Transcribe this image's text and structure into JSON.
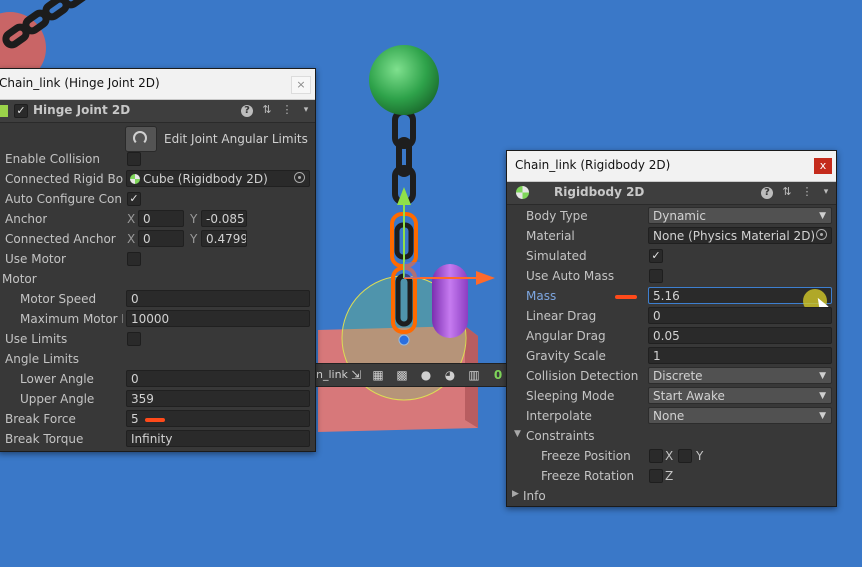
{
  "hinge_window": {
    "title": "Chain_link (Hinge Joint 2D)",
    "close": "×",
    "component": "Hinge Joint 2D",
    "enabled_check": "✓",
    "help": "?",
    "settings": "⇅",
    "menu": "⋮",
    "pin": "📌",
    "edit_button_label": "Edit Joint Angular Limits",
    "fields": {
      "enable_collision": {
        "label": "Enable Collision",
        "checked": ""
      },
      "connected_rigid_body": {
        "label": "Connected Rigid Bod",
        "value": "Cube (Rigidbody 2D)"
      },
      "auto_configure": {
        "label": "Auto Configure Conne",
        "checked": "✓"
      },
      "anchor": {
        "label": "Anchor",
        "x_label": "X",
        "x": "0",
        "y_label": "Y",
        "y": "-0.085"
      },
      "connected_anchor": {
        "label": "Connected Anchor",
        "x_label": "X",
        "x": "0",
        "y_label": "Y",
        "y": "0.4799"
      },
      "use_motor": {
        "label": "Use Motor",
        "checked": ""
      },
      "motor_header": "Motor",
      "motor_speed": {
        "label": "Motor Speed",
        "value": "0"
      },
      "max_motor_force": {
        "label": "Maximum Motor Fo",
        "value": "10000"
      },
      "use_limits": {
        "label": "Use Limits",
        "checked": ""
      },
      "angle_limits_header": "Angle Limits",
      "lower_angle": {
        "label": "Lower Angle",
        "value": "0"
      },
      "upper_angle": {
        "label": "Upper Angle",
        "value": "359"
      },
      "break_force": {
        "label": "Break Force",
        "value": "5"
      },
      "break_torque": {
        "label": "Break Torque",
        "value": "Infinity"
      }
    }
  },
  "rigidbody_window": {
    "title": "Chain_link (Rigidbody 2D)",
    "close": "x",
    "component": "Rigidbody 2D",
    "help": "?",
    "settings": "⇅",
    "menu": "⋮",
    "pin": "📌",
    "fields": {
      "body_type": {
        "label": "Body Type",
        "value": "Dynamic"
      },
      "material": {
        "label": "Material",
        "value": "None (Physics Material 2D)"
      },
      "simulated": {
        "label": "Simulated",
        "checked": "✓"
      },
      "use_auto_mass": {
        "label": "Use Auto Mass",
        "checked": ""
      },
      "mass": {
        "label": "Mass",
        "value": "5.16"
      },
      "linear_drag": {
        "label": "Linear Drag",
        "value": "0"
      },
      "angular_drag": {
        "label": "Angular Drag",
        "value": "0.05"
      },
      "gravity_scale": {
        "label": "Gravity Scale",
        "value": "1"
      },
      "collision_detection": {
        "label": "Collision Detection",
        "value": "Discrete"
      },
      "sleeping_mode": {
        "label": "Sleeping Mode",
        "value": "Start Awake"
      },
      "interpolate": {
        "label": "Interpolate",
        "value": "None"
      },
      "constraints_header": "Constraints",
      "freeze_position": {
        "label": "Freeze Position",
        "x": "X",
        "y": "Y"
      },
      "freeze_rotation": {
        "label": "Freeze Rotation",
        "z": "Z"
      },
      "info_header": "Info"
    }
  },
  "scene_toolbar": {
    "object_label": "n_link",
    "icons": [
      "transform-gizmo-icon",
      "grid-icon",
      "grid-snap-icon",
      "shading-sphere-icon",
      "physics-icon",
      "layout-icon",
      "zero-icon"
    ],
    "zero_label": "0"
  },
  "colors": {
    "scene_background": "#3a78c8",
    "mass_label": "#7da6e0",
    "annotation": "#ff4a1a",
    "selection_outline": "#ff6a00"
  }
}
